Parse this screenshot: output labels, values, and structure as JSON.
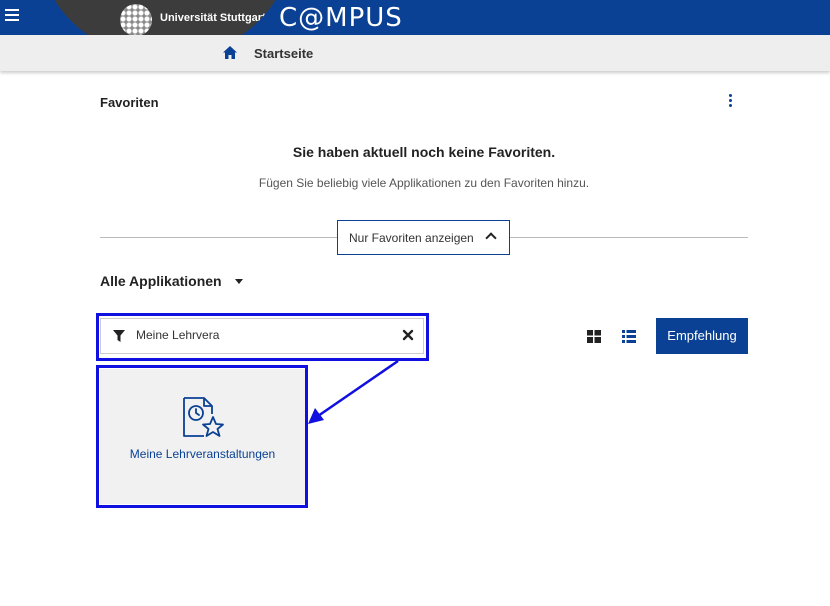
{
  "header": {
    "university": "Universität Stuttgart",
    "app_title": "C@MPUS",
    "menu_icon": "hamburger-icon",
    "brand_color": "#0a4194"
  },
  "breadcrumb": {
    "home_icon": "home-icon",
    "current": "Startseite"
  },
  "favorites": {
    "title": "Favoriten",
    "empty_title": "Sie haben aktuell noch keine Favoriten.",
    "empty_subtitle": "Fügen Sie beliebig viele Applikationen zu den Favoriten hinzu.",
    "toggle_label": "Nur Favoriten anzeigen"
  },
  "apps": {
    "title": "Alle Applikationen",
    "search_value": "Meine Lehrvera",
    "recommend_label": "Empfehlung",
    "tiles": [
      {
        "label": "Meine Lehrveranstaltungen",
        "icon": "document-clock-star-icon"
      }
    ]
  },
  "annotations": {
    "highlight_color": "#1010e0"
  }
}
